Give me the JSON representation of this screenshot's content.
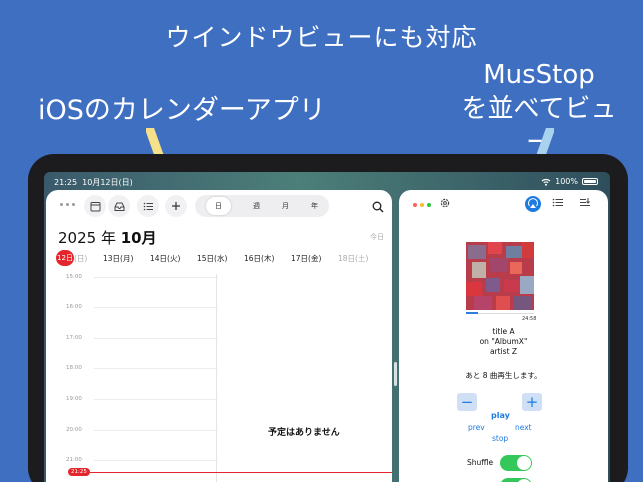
{
  "promo": {
    "title": "ウインドウビューにも対応",
    "left_caption": "iOSのカレンダーアプリ",
    "right_caption_line1": "MusStop",
    "right_caption_line2": "を並べてビュー"
  },
  "status_bar": {
    "time": "21:25",
    "date": "10月12日(日)",
    "battery": "100%"
  },
  "calendar": {
    "view_tabs": [
      "日",
      "週",
      "月",
      "年"
    ],
    "selected_tab": "日",
    "year_label": "2025 年",
    "month_label": "10月",
    "today_label": "今日",
    "days": [
      {
        "num": "12日",
        "wd": "(日)",
        "selected": true
      },
      {
        "label": "13日(月)"
      },
      {
        "label": "14日(火)"
      },
      {
        "label": "15日(水)"
      },
      {
        "label": "16日(木)"
      },
      {
        "label": "17日(金)"
      },
      {
        "label": "18日(土)",
        "past": true
      }
    ],
    "hours": [
      "15:00",
      "16:00",
      "17:00",
      "18:00",
      "19:00",
      "20:00",
      "21:00"
    ],
    "now_label": "21:25",
    "no_events": "予定はありません"
  },
  "player": {
    "track_title": "title A",
    "track_album": "on \"AlbumX\"",
    "track_artist": "artist Z",
    "duration": "24:58",
    "progress": 0.18,
    "remaining": "あと 8 曲再生します。",
    "minus_label": "−",
    "plus_label": "+",
    "play_label": "play",
    "prev_label": "prev",
    "next_label": "next",
    "stop_label": "stop",
    "shuffle_label": "Shuffle",
    "shuffle_on": true,
    "accent": "#1e7be0",
    "toggle_on_color": "#34c759"
  },
  "colors": {
    "background": "#3f6fc1",
    "today_red": "#e3262c",
    "arrow_yellow": "#f6e08a",
    "arrow_blue": "#a9d2ef"
  }
}
